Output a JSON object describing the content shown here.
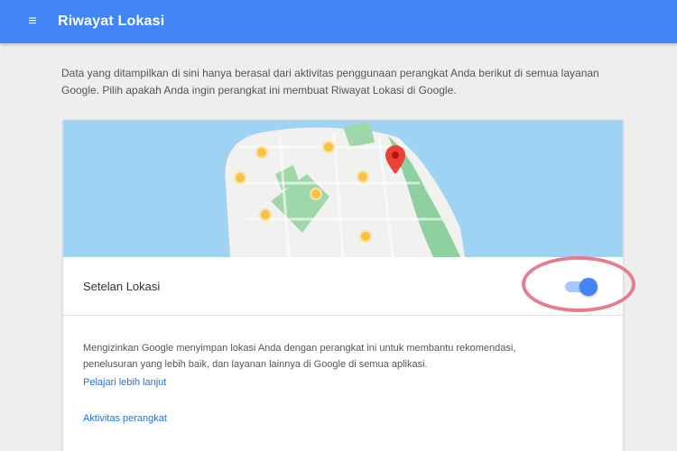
{
  "app": {
    "title": "Riwayat Lokasi"
  },
  "intro": {
    "text": "Data yang ditampilkan di sini hanya berasal dari aktivitas penggunaan perangkat Anda berikut di semua layanan Google. Pilih apakah Anda ingin perangkat ini membuat Riwayat Lokasi di Google."
  },
  "card": {
    "toggle_label": "Setelan Lokasi",
    "toggle_on": true,
    "description": "Mengizinkan Google menyimpan lokasi Anda dengan perangkat ini untuk membantu rekomendasi, penelusuran yang lebih baik, dan layanan lainnya di Google di semua aplikasi.",
    "link_more": "Pelajari lebih lanjut",
    "link_settings": "Aktivitas perangkat"
  },
  "colors": {
    "appbar": "#4285f4",
    "map_water": "#9fd3f3",
    "map_land": "#f1f1ef",
    "map_park": "#8fd19e",
    "pin": "#ea4335",
    "toggle_on": "#4285f4",
    "highlight_ring": "#e77c8d"
  }
}
